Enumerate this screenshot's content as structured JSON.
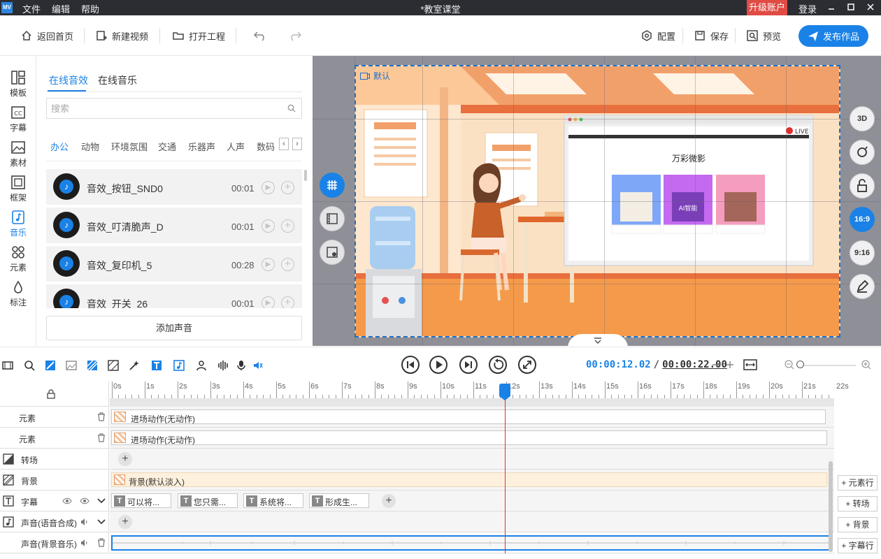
{
  "app": {
    "logo": "MV",
    "menu": [
      "文件",
      "编辑",
      "帮助"
    ],
    "title": "*教室课堂",
    "upgrade": "升级账户",
    "login": "登录"
  },
  "toolbar": {
    "home": "返回首页",
    "new_video": "新建视频",
    "open_project": "打开工程",
    "config": "配置",
    "save": "保存",
    "preview": "预览",
    "publish": "发布作品"
  },
  "leftnav": [
    {
      "label": "模板",
      "icon": "template-icon"
    },
    {
      "label": "字幕",
      "icon": "caption-icon"
    },
    {
      "label": "素材",
      "icon": "image-icon"
    },
    {
      "label": "框架",
      "icon": "frame-icon"
    },
    {
      "label": "音乐",
      "icon": "music-icon",
      "active": true
    },
    {
      "label": "元素",
      "icon": "elements-icon"
    },
    {
      "label": "标注",
      "icon": "drop-icon"
    }
  ],
  "panel": {
    "tabs": [
      "在线音效",
      "在线音乐"
    ],
    "search_placeholder": "搜索",
    "categories": [
      "办公",
      "动物",
      "环境氛围",
      "交通",
      "乐器声",
      "人声",
      "数码"
    ],
    "sounds": [
      {
        "name": "音效_按钮_SND0",
        "duration": "00:01"
      },
      {
        "name": "音效_叮清脆声_D",
        "duration": "00:01"
      },
      {
        "name": "音效_复印机_5",
        "duration": "00:28"
      },
      {
        "name": "音效_开关_26",
        "duration": "00:01"
      }
    ],
    "add_sound": "添加声音"
  },
  "canvas": {
    "scene_label": "默认",
    "ratio_options": [
      "3D",
      "16:9",
      "9:16"
    ],
    "screen_title": "万彩微影",
    "live": "LIVE",
    "card_label": "AI智能"
  },
  "playback": {
    "current": "00:00:12.02",
    "separator": "/",
    "total": "00:00:22.00"
  },
  "timeline": {
    "ticks": [
      "0s",
      "1s",
      "2s",
      "3s",
      "4s",
      "5s",
      "6s",
      "7s",
      "8s",
      "9s",
      "10s",
      "11s",
      "12s",
      "13s",
      "14s",
      "15s",
      "16s",
      "17s",
      "18s",
      "19s",
      "20s",
      "21s",
      "22s"
    ],
    "tracks": [
      {
        "label": "元素",
        "clip": "进场动作(无动作)"
      },
      {
        "label": "元素",
        "clip": "进场动作(无动作)"
      },
      {
        "label": "转场"
      },
      {
        "label": "背景",
        "clip": "背景(默认淡入)"
      },
      {
        "label": "字幕",
        "subs": [
          "可以将...",
          "您只需...",
          "系统将...",
          "形成生..."
        ]
      },
      {
        "label": "声音(语音合成)"
      },
      {
        "label": "声音(背景音乐)"
      }
    ],
    "side_buttons": [
      "元素行",
      "转场",
      "背景",
      "字幕行"
    ]
  },
  "colors": {
    "accent": "#1a82e6",
    "titlebar": "#2b2d33",
    "upgrade": "#e04b44",
    "playhead": "#e03030"
  }
}
